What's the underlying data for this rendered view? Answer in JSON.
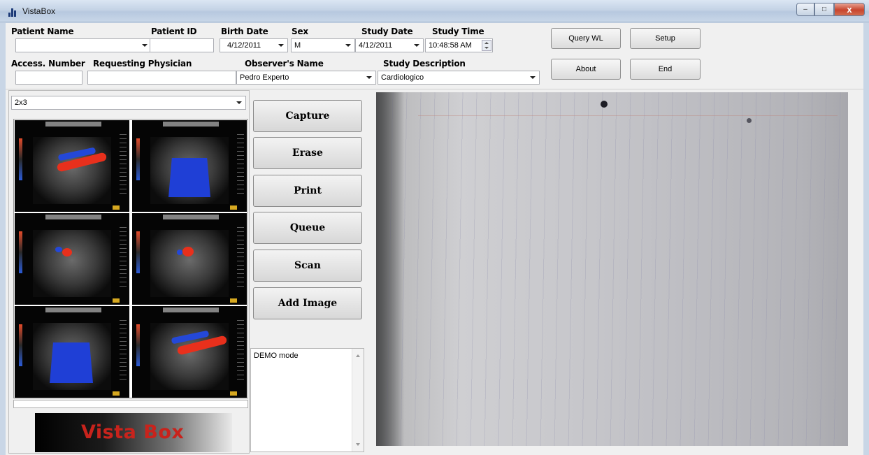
{
  "window": {
    "title": "VistaBox",
    "min_glyph": "–",
    "max_glyph": "□",
    "close_glyph": "x"
  },
  "patient": {
    "name_label": "Patient Name",
    "name_value": "",
    "id_label": "Patient ID",
    "id_value": "",
    "birth_label": "Birth Date",
    "birth_value": "4/12/2011",
    "sex_label": "Sex",
    "sex_value": "M",
    "study_date_label": "Study Date",
    "study_date_value": "4/12/2011",
    "study_time_label": "Study Time",
    "study_time_value": "10:48:58 AM",
    "access_label": "Access. Number",
    "access_value": "",
    "physician_label": "Requesting Physician",
    "physician_value": "",
    "observer_label": "Observer's Name",
    "observer_value": "Pedro Experto",
    "study_desc_label": "Study Description",
    "study_desc_value": "Cardiologico"
  },
  "top_buttons": {
    "query": "Query WL",
    "setup": "Setup",
    "about": "About",
    "end": "End"
  },
  "layout_select": {
    "value": "2x3"
  },
  "actions": {
    "capture": "Capture",
    "erase": "Erase",
    "print": "Print",
    "queue": "Queue",
    "scan": "Scan",
    "add_image": "Add Image"
  },
  "log": {
    "text": "DEMO mode"
  },
  "logo": {
    "text": "Vista Box"
  },
  "thumbnails": [
    {
      "name": "thumb-1",
      "doppler": "red-blue-vessel"
    },
    {
      "name": "thumb-2",
      "doppler": "blue-sector"
    },
    {
      "name": "thumb-3",
      "doppler": "red-blue-spot"
    },
    {
      "name": "thumb-4",
      "doppler": "red-blue-spot"
    },
    {
      "name": "thumb-5",
      "doppler": "blue-sector"
    },
    {
      "name": "thumb-6",
      "doppler": "red-blue-vessel"
    }
  ],
  "colors": {
    "accent_red": "#c8231c",
    "doppler_red": "#e8301c",
    "doppler_blue": "#1f3fd6"
  }
}
